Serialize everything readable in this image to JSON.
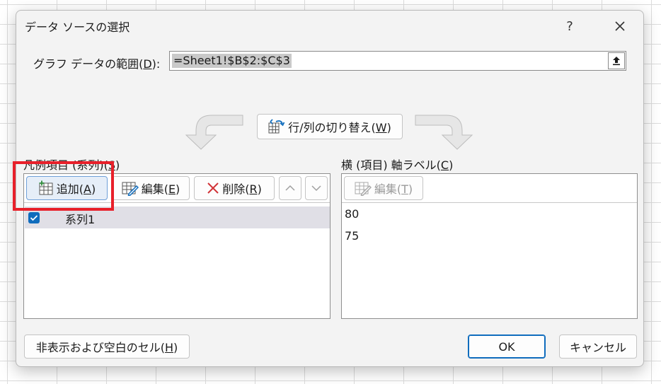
{
  "dialog": {
    "title": "データ ソースの選択",
    "help_label": "?"
  },
  "range": {
    "label_prefix": "グラフ データの範囲(",
    "label_key": "D",
    "label_suffix": "):",
    "value": "=Sheet1!$B$2:$C$3"
  },
  "switch_button": {
    "label_prefix": "行/列の切り替え(",
    "label_key": "W",
    "label_suffix": ")"
  },
  "legend_panel": {
    "title_prefix": "凡例項目 (系列)(",
    "title_key": "S",
    "title_suffix": ")",
    "add": {
      "prefix": "追加(",
      "key": "A",
      "suffix": ")"
    },
    "edit": {
      "prefix": "編集(",
      "key": "E",
      "suffix": ")"
    },
    "delete": {
      "prefix": "削除(",
      "key": "R",
      "suffix": ")"
    },
    "series": [
      {
        "name": "系列1",
        "checked": true
      }
    ]
  },
  "axis_panel": {
    "title_prefix": "横 (項目) 軸ラベル(",
    "title_key": "C",
    "title_suffix": ")",
    "edit": {
      "prefix": "編集(",
      "key": "T",
      "suffix": ")"
    },
    "items": [
      "80",
      "75"
    ]
  },
  "footer": {
    "hidden_cells": {
      "prefix": "非表示および空白のセル(",
      "key": "H",
      "suffix": ")"
    },
    "ok": "OK",
    "cancel": "キャンセル"
  },
  "colors": {
    "accent": "#0f6cbd",
    "highlight": "#e8202a",
    "delete_red": "#d13438",
    "add_green": "#2e8b3a"
  }
}
